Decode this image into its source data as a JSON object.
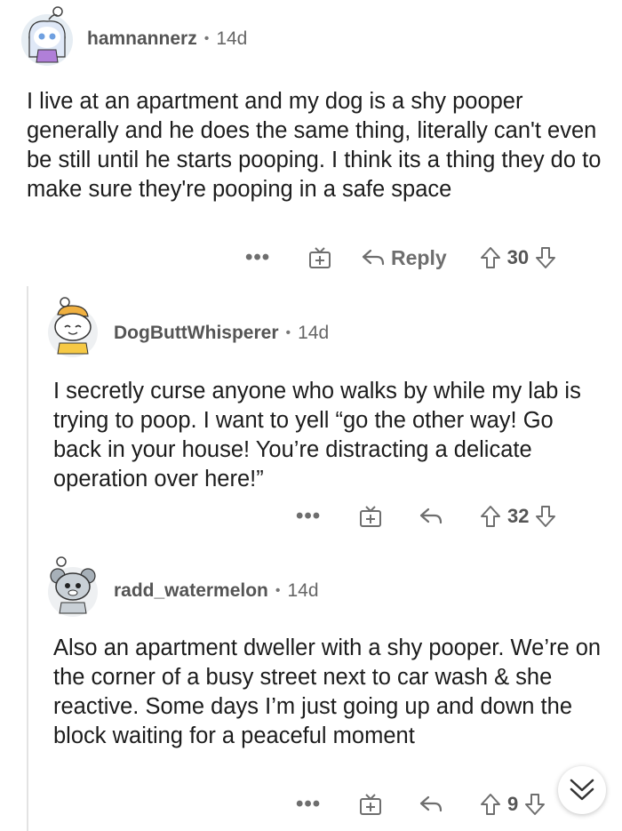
{
  "comments": [
    {
      "username": "hamnannerz",
      "time": "14d",
      "body": "I live at an apartment and my dog is a shy pooper generally and he does the same thing, literally can't even be still until he starts pooping. I think its a thing they do to make sure they're pooping in a safe space",
      "reply_label": "Reply",
      "votes": "30"
    },
    {
      "username": "DogButtWhisperer",
      "time": "14d",
      "body": "I secretly curse anyone who walks by while my lab is trying to poop. I want to yell “go the other way! Go back in your house! You’re distracting a delicate operation over here!”",
      "votes": "32"
    },
    {
      "username": "radd_watermelon",
      "time": "14d",
      "body": "Also an apartment dweller with a shy pooper. We’re on the corner of a busy street next to car wash & she reactive. Some days I’m just going up and down the block waiting for a peaceful moment",
      "votes": "9"
    }
  ],
  "more_label": "•••",
  "separator": "•",
  "icons": {
    "more": "more-options-icon",
    "award": "award-gift-icon",
    "reply": "reply-arrow-icon",
    "upvote": "upvote-arrow-icon",
    "downvote": "downvote-arrow-icon",
    "scroll": "scroll-down-chevron-icon"
  },
  "colors": {
    "text": "#1c1c1c",
    "meta": "#666666",
    "icon": "#6e6e6e",
    "thread_line": "#e3e3e3"
  }
}
